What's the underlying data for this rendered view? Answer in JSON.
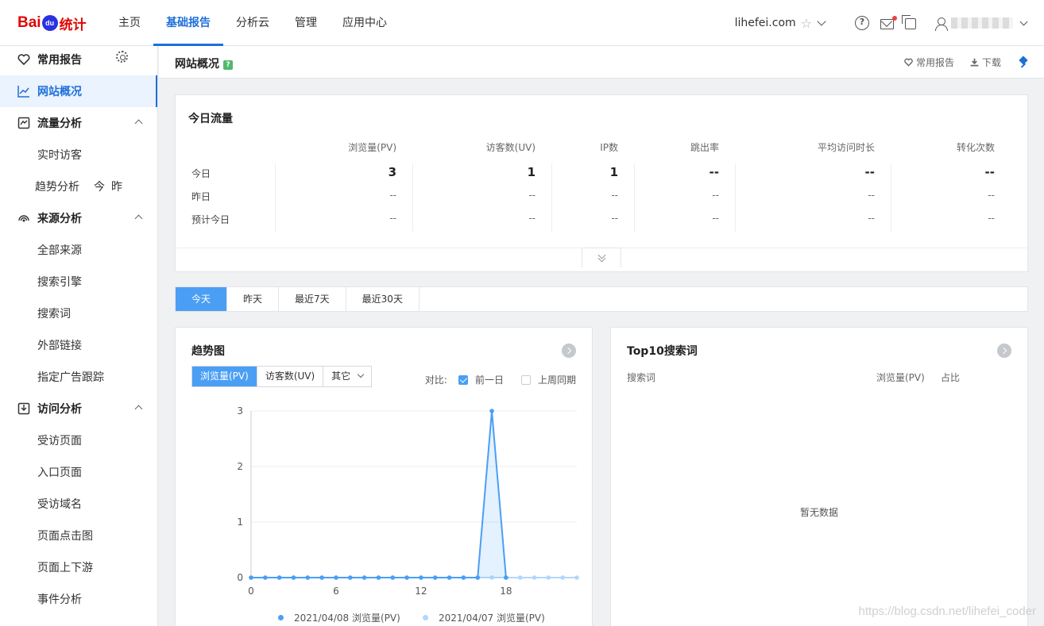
{
  "brand": {
    "bai": "Bai",
    "du": "du",
    "tongji": "统计"
  },
  "nav": [
    "主页",
    "基础报告",
    "分析云",
    "管理",
    "应用中心"
  ],
  "site": "lihefei.com",
  "sidebar": {
    "favorites": "常用报告",
    "overview": "网站概况",
    "traffic": "流量分析",
    "realtime": "实时访客",
    "trend": "趋势分析",
    "trend_today": "今",
    "trend_yesterday": "昨",
    "source": "来源分析",
    "all_source": "全部来源",
    "search_engine": "搜索引擎",
    "search_word": "搜索词",
    "external_link": "外部链接",
    "ad_track": "指定广告跟踪",
    "visit": "访问分析",
    "visited_page": "受访页面",
    "entry_page": "入口页面",
    "visited_domain": "受访域名",
    "page_click": "页面点击图",
    "page_flow": "页面上下游",
    "event": "事件分析"
  },
  "page": {
    "title": "网站概况",
    "help": "?",
    "fav": "常用报告",
    "download": "下载"
  },
  "today_flow": {
    "title": "今日流量",
    "columns": [
      "浏览量(PV)",
      "访客数(UV)",
      "IP数",
      "跳出率",
      "平均访问时长",
      "转化次数"
    ],
    "rows": [
      {
        "label": "今日",
        "values": [
          "3",
          "1",
          "1",
          "--",
          "--",
          "--"
        ]
      },
      {
        "label": "昨日",
        "values": [
          "--",
          "--",
          "--",
          "--",
          "--",
          "--"
        ]
      },
      {
        "label": "预计今日",
        "values": [
          "--",
          "--",
          "--",
          "--",
          "--",
          "--"
        ]
      }
    ]
  },
  "tabs": [
    "今天",
    "昨天",
    "最近7天",
    "最近30天"
  ],
  "trend": {
    "title": "趋势图",
    "metrics": [
      "浏览量(PV)",
      "访客数(UV)",
      "其它"
    ],
    "compare_label": "对比:",
    "compare_prev_day": "前一日",
    "compare_last_week": "上周同期"
  },
  "chart_data": {
    "type": "line",
    "x": [
      0,
      1,
      2,
      3,
      4,
      5,
      6,
      7,
      8,
      9,
      10,
      11,
      12,
      13,
      14,
      15,
      16,
      17,
      18,
      19,
      20,
      21,
      22,
      23
    ],
    "xticks": [
      "0",
      "6",
      "12",
      "18"
    ],
    "yticks": [
      "0",
      "1",
      "2",
      "3"
    ],
    "ylim": [
      0,
      3
    ],
    "series": [
      {
        "name": "2021/04/08 浏览量(PV)",
        "color": "#4a9ff5",
        "values": [
          0,
          0,
          0,
          0,
          0,
          0,
          0,
          0,
          0,
          0,
          0,
          0,
          0,
          0,
          0,
          0,
          0,
          3,
          0,
          null,
          null,
          null,
          null,
          null
        ]
      },
      {
        "name": "2021/04/07 浏览量(PV)",
        "color": "#b3d7fa",
        "values": [
          0,
          0,
          0,
          0,
          0,
          0,
          0,
          0,
          0,
          0,
          0,
          0,
          0,
          0,
          0,
          0,
          0,
          0,
          0,
          0,
          0,
          0,
          0,
          0
        ]
      }
    ]
  },
  "top10": {
    "title": "Top10搜索词",
    "col_word": "搜索词",
    "col_pv": "浏览量(PV)",
    "col_ratio": "占比",
    "empty": "暂无数据"
  },
  "watermark": "https://blog.csdn.net/lihefei_coder"
}
